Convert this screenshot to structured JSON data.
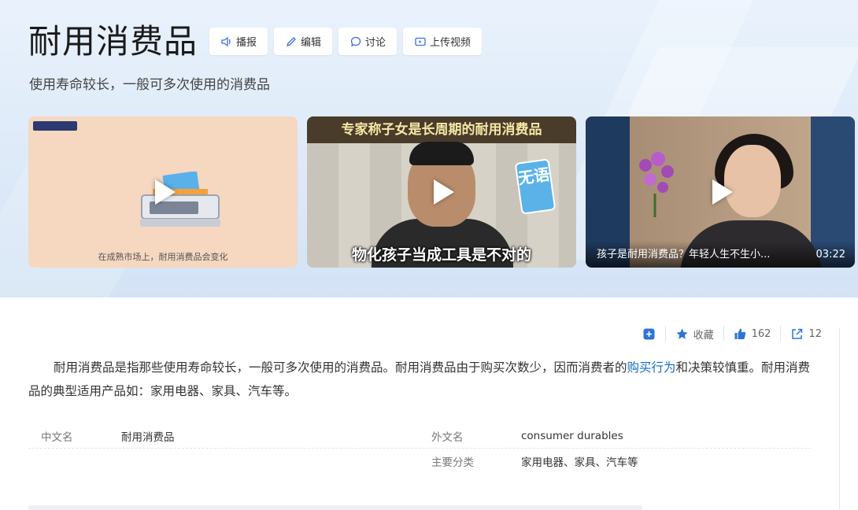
{
  "header": {
    "title": "耐用消费品",
    "subtitle": "使用寿命较长，一般可多次使用的消费品",
    "actions": [
      {
        "label": "播报",
        "icon": "speaker-icon"
      },
      {
        "label": "编辑",
        "icon": "pencil-icon"
      },
      {
        "label": "讨论",
        "icon": "chat-icon"
      },
      {
        "label": "上传视频",
        "icon": "video-icon"
      }
    ]
  },
  "videos": [
    {
      "caption": "在成熟市场上，耐用消费品会变化",
      "duration": ""
    },
    {
      "top_caption": "专家称子女是长周期的耐用消费品",
      "badge": "无语",
      "caption": "物化孩子当成工具是不对的",
      "duration": ""
    },
    {
      "caption": "孩子是耐用消费品？年轻人生不生小...",
      "duration": "03:22"
    }
  ],
  "stats": {
    "favorite_label": "收藏",
    "likes": "162",
    "shares": "12"
  },
  "content": {
    "p1": "耐用消费品是指那些使用寿命较长，一般可多次使用的消费品。耐用消费品由于购买次数少，因而消费者的",
    "link": "购买行为",
    "p2": "和决策较慎重。耐用消费品的典型适用产品如：家用电器、家具、汽车等。"
  },
  "info": {
    "row1": {
      "label1": "中文名",
      "value1": "耐用消费品",
      "label2": "外文名",
      "value2": "consumer durables"
    },
    "row2": {
      "label2": "主要分类",
      "value2": "家用电器、家具、汽车等"
    }
  },
  "colors": {
    "accent": "#136ec2",
    "hero_bg": "#dce9f8"
  }
}
